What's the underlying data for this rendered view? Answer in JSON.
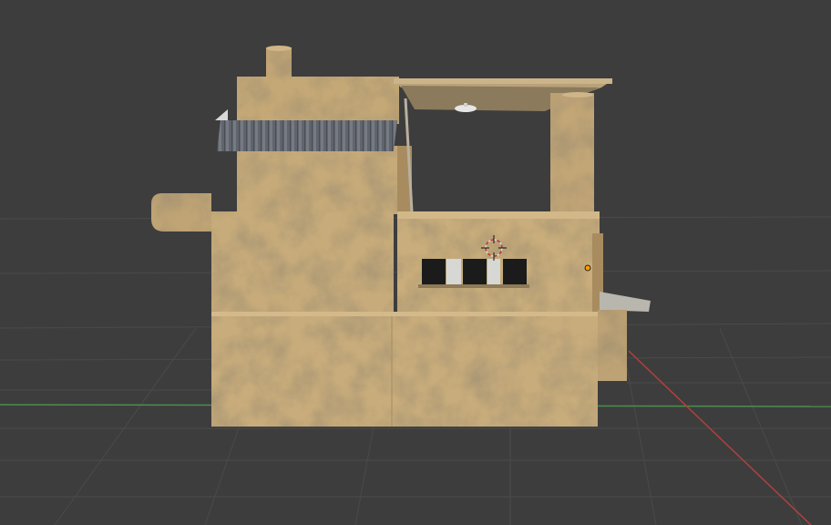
{
  "viewport": {
    "background": "#3d3d3d",
    "grid_color": "#474747",
    "x_axis_color": "#b0413e",
    "y_axis_color": "#4a8f4e"
  },
  "scene": {
    "object": "building",
    "wall_color": "#c6a978",
    "wall_shadow_color": "#a88c5f",
    "roof_color": "#5f636b",
    "window_color": "#1b1b1b"
  },
  "icons": {
    "cursor": "3d-cursor-icon",
    "origin": "object-origin-icon",
    "light": "ceiling-lamp-icon"
  }
}
